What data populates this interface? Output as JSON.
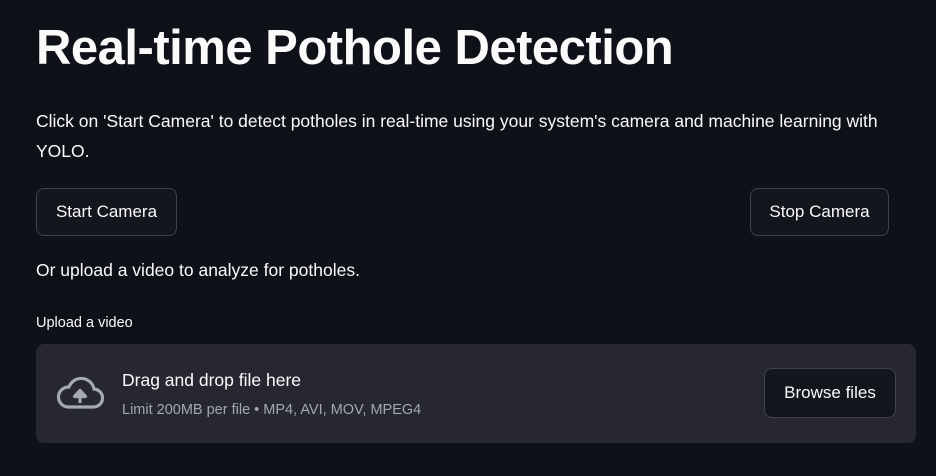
{
  "header": {
    "title": "Real-time Pothole Detection"
  },
  "description": "Click on 'Start Camera' to detect potholes in real-time using your system's camera and machine learning with YOLO.",
  "buttons": {
    "start": "Start Camera",
    "stop": "Stop Camera"
  },
  "upload_hint": "Or upload a video to analyze for potholes.",
  "uploader": {
    "label": "Upload a video",
    "drop_title": "Drag and drop file here",
    "limit_text": "Limit 200MB per file • MP4, AVI, MOV, MPEG4",
    "browse_label": "Browse files",
    "icon": "cloud-upload-icon"
  },
  "colors": {
    "background": "#0e1117",
    "dropzone": "#262730",
    "text": "#fafafa"
  }
}
